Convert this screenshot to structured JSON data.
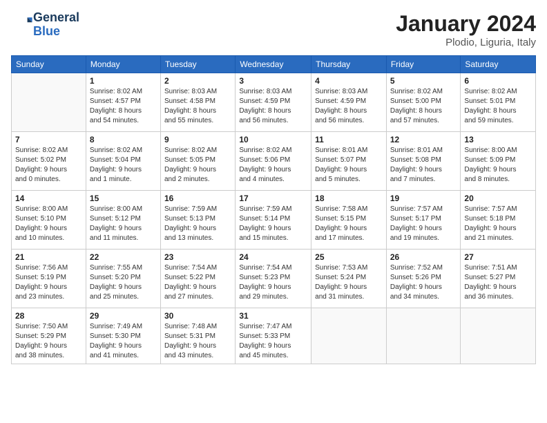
{
  "header": {
    "logo_line1": "General",
    "logo_line2": "Blue",
    "month_year": "January 2024",
    "location": "Plodio, Liguria, Italy"
  },
  "days_of_week": [
    "Sunday",
    "Monday",
    "Tuesday",
    "Wednesday",
    "Thursday",
    "Friday",
    "Saturday"
  ],
  "weeks": [
    [
      {
        "day": "",
        "info": ""
      },
      {
        "day": "1",
        "info": "Sunrise: 8:02 AM\nSunset: 4:57 PM\nDaylight: 8 hours\nand 54 minutes."
      },
      {
        "day": "2",
        "info": "Sunrise: 8:03 AM\nSunset: 4:58 PM\nDaylight: 8 hours\nand 55 minutes."
      },
      {
        "day": "3",
        "info": "Sunrise: 8:03 AM\nSunset: 4:59 PM\nDaylight: 8 hours\nand 56 minutes."
      },
      {
        "day": "4",
        "info": "Sunrise: 8:03 AM\nSunset: 4:59 PM\nDaylight: 8 hours\nand 56 minutes."
      },
      {
        "day": "5",
        "info": "Sunrise: 8:02 AM\nSunset: 5:00 PM\nDaylight: 8 hours\nand 57 minutes."
      },
      {
        "day": "6",
        "info": "Sunrise: 8:02 AM\nSunset: 5:01 PM\nDaylight: 8 hours\nand 59 minutes."
      }
    ],
    [
      {
        "day": "7",
        "info": "Sunrise: 8:02 AM\nSunset: 5:02 PM\nDaylight: 9 hours\nand 0 minutes."
      },
      {
        "day": "8",
        "info": "Sunrise: 8:02 AM\nSunset: 5:04 PM\nDaylight: 9 hours\nand 1 minute."
      },
      {
        "day": "9",
        "info": "Sunrise: 8:02 AM\nSunset: 5:05 PM\nDaylight: 9 hours\nand 2 minutes."
      },
      {
        "day": "10",
        "info": "Sunrise: 8:02 AM\nSunset: 5:06 PM\nDaylight: 9 hours\nand 4 minutes."
      },
      {
        "day": "11",
        "info": "Sunrise: 8:01 AM\nSunset: 5:07 PM\nDaylight: 9 hours\nand 5 minutes."
      },
      {
        "day": "12",
        "info": "Sunrise: 8:01 AM\nSunset: 5:08 PM\nDaylight: 9 hours\nand 7 minutes."
      },
      {
        "day": "13",
        "info": "Sunrise: 8:00 AM\nSunset: 5:09 PM\nDaylight: 9 hours\nand 8 minutes."
      }
    ],
    [
      {
        "day": "14",
        "info": "Sunrise: 8:00 AM\nSunset: 5:10 PM\nDaylight: 9 hours\nand 10 minutes."
      },
      {
        "day": "15",
        "info": "Sunrise: 8:00 AM\nSunset: 5:12 PM\nDaylight: 9 hours\nand 11 minutes."
      },
      {
        "day": "16",
        "info": "Sunrise: 7:59 AM\nSunset: 5:13 PM\nDaylight: 9 hours\nand 13 minutes."
      },
      {
        "day": "17",
        "info": "Sunrise: 7:59 AM\nSunset: 5:14 PM\nDaylight: 9 hours\nand 15 minutes."
      },
      {
        "day": "18",
        "info": "Sunrise: 7:58 AM\nSunset: 5:15 PM\nDaylight: 9 hours\nand 17 minutes."
      },
      {
        "day": "19",
        "info": "Sunrise: 7:57 AM\nSunset: 5:17 PM\nDaylight: 9 hours\nand 19 minutes."
      },
      {
        "day": "20",
        "info": "Sunrise: 7:57 AM\nSunset: 5:18 PM\nDaylight: 9 hours\nand 21 minutes."
      }
    ],
    [
      {
        "day": "21",
        "info": "Sunrise: 7:56 AM\nSunset: 5:19 PM\nDaylight: 9 hours\nand 23 minutes."
      },
      {
        "day": "22",
        "info": "Sunrise: 7:55 AM\nSunset: 5:20 PM\nDaylight: 9 hours\nand 25 minutes."
      },
      {
        "day": "23",
        "info": "Sunrise: 7:54 AM\nSunset: 5:22 PM\nDaylight: 9 hours\nand 27 minutes."
      },
      {
        "day": "24",
        "info": "Sunrise: 7:54 AM\nSunset: 5:23 PM\nDaylight: 9 hours\nand 29 minutes."
      },
      {
        "day": "25",
        "info": "Sunrise: 7:53 AM\nSunset: 5:24 PM\nDaylight: 9 hours\nand 31 minutes."
      },
      {
        "day": "26",
        "info": "Sunrise: 7:52 AM\nSunset: 5:26 PM\nDaylight: 9 hours\nand 34 minutes."
      },
      {
        "day": "27",
        "info": "Sunrise: 7:51 AM\nSunset: 5:27 PM\nDaylight: 9 hours\nand 36 minutes."
      }
    ],
    [
      {
        "day": "28",
        "info": "Sunrise: 7:50 AM\nSunset: 5:29 PM\nDaylight: 9 hours\nand 38 minutes."
      },
      {
        "day": "29",
        "info": "Sunrise: 7:49 AM\nSunset: 5:30 PM\nDaylight: 9 hours\nand 41 minutes."
      },
      {
        "day": "30",
        "info": "Sunrise: 7:48 AM\nSunset: 5:31 PM\nDaylight: 9 hours\nand 43 minutes."
      },
      {
        "day": "31",
        "info": "Sunrise: 7:47 AM\nSunset: 5:33 PM\nDaylight: 9 hours\nand 45 minutes."
      },
      {
        "day": "",
        "info": ""
      },
      {
        "day": "",
        "info": ""
      },
      {
        "day": "",
        "info": ""
      }
    ]
  ]
}
